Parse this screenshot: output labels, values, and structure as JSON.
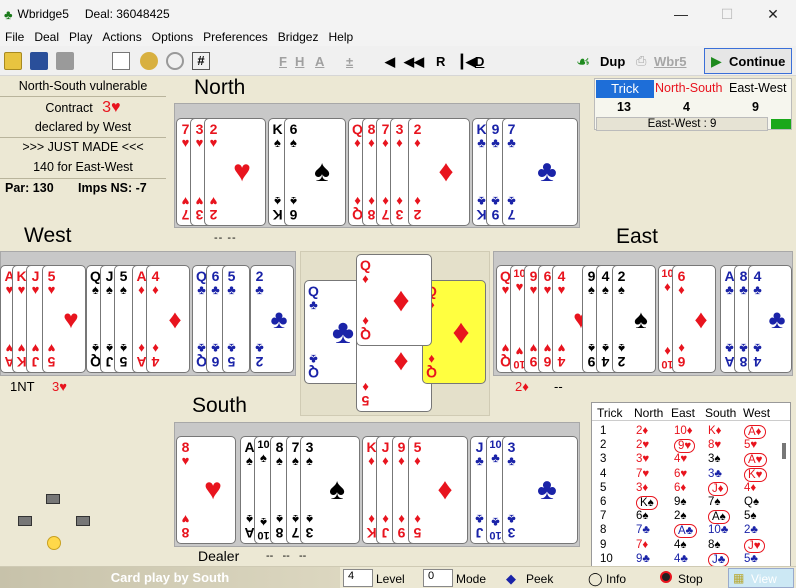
{
  "window": {
    "title": "Wbridge5",
    "deal_label": "Deal: 36048425"
  },
  "menu": [
    "File",
    "Deal",
    "Play",
    "Actions",
    "Options",
    "Preferences",
    "Bridgez",
    "Help"
  ],
  "toolbar": {
    "nav": [
      "F",
      "H",
      "A",
      "±",
      "R",
      "D"
    ],
    "dup_label": "Dup",
    "wbr5_label": "Wbr5",
    "continue_label": "Continue"
  },
  "info": {
    "vulnerability": "North-South vulnerable",
    "contract_label": "Contract",
    "contract": "3♥",
    "declarer": "declared by West",
    "result": ">>> JUST MADE <<<",
    "points": "140 for East-West",
    "par": "Par: 130",
    "imps": "Imps NS: -7"
  },
  "seats": {
    "north": "North",
    "west": "West",
    "east": "East",
    "south": "South",
    "north_marks": "-- --",
    "west_bid": "1NT",
    "west_bid2": "3♥",
    "east_bid": "2♦",
    "east_marks": "--",
    "dealer": "Dealer",
    "south_marks": "--   --   --"
  },
  "hands": {
    "north": [
      {
        "r": "7",
        "s": "♥",
        "c": "red"
      },
      {
        "r": "3",
        "s": "♥",
        "c": "red"
      },
      {
        "r": "2",
        "s": "♥",
        "c": "red"
      },
      {
        "r": "K",
        "s": "♠",
        "c": "blk"
      },
      {
        "r": "6",
        "s": "♠",
        "c": "blk"
      },
      {
        "r": "Q",
        "s": "♦",
        "c": "red"
      },
      {
        "r": "8",
        "s": "♦",
        "c": "red"
      },
      {
        "r": "7",
        "s": "♦",
        "c": "red"
      },
      {
        "r": "3",
        "s": "♦",
        "c": "red"
      },
      {
        "r": "2",
        "s": "♦",
        "c": "red"
      },
      {
        "r": "K",
        "s": "♣",
        "c": "blu"
      },
      {
        "r": "9",
        "s": "♣",
        "c": "blu"
      },
      {
        "r": "7",
        "s": "♣",
        "c": "blu"
      }
    ],
    "west": [
      {
        "r": "A",
        "s": "♥",
        "c": "red"
      },
      {
        "r": "K",
        "s": "♥",
        "c": "red"
      },
      {
        "r": "J",
        "s": "♥",
        "c": "red"
      },
      {
        "r": "5",
        "s": "♥",
        "c": "red"
      },
      {
        "r": "Q",
        "s": "♠",
        "c": "blk"
      },
      {
        "r": "J",
        "s": "♠",
        "c": "blk"
      },
      {
        "r": "5",
        "s": "♠",
        "c": "blk"
      },
      {
        "r": "A",
        "s": "♦",
        "c": "red"
      },
      {
        "r": "4",
        "s": "♦",
        "c": "red"
      },
      {
        "r": "Q",
        "s": "♣",
        "c": "blu"
      },
      {
        "r": "6",
        "s": "♣",
        "c": "blu"
      },
      {
        "r": "5",
        "s": "♣",
        "c": "blu"
      },
      {
        "r": "2",
        "s": "♣",
        "c": "blu"
      }
    ],
    "east": [
      {
        "r": "Q",
        "s": "♥",
        "c": "red"
      },
      {
        "r": "10",
        "s": "♥",
        "c": "red"
      },
      {
        "r": "9",
        "s": "♥",
        "c": "red"
      },
      {
        "r": "6",
        "s": "♥",
        "c": "red"
      },
      {
        "r": "4",
        "s": "♥",
        "c": "red"
      },
      {
        "r": "9",
        "s": "♠",
        "c": "blk"
      },
      {
        "r": "4",
        "s": "♠",
        "c": "blk"
      },
      {
        "r": "2",
        "s": "♠",
        "c": "blk"
      },
      {
        "r": "10",
        "s": "♦",
        "c": "red"
      },
      {
        "r": "6",
        "s": "♦",
        "c": "red"
      },
      {
        "r": "A",
        "s": "♣",
        "c": "blu"
      },
      {
        "r": "8",
        "s": "♣",
        "c": "blu"
      },
      {
        "r": "4",
        "s": "♣",
        "c": "blu"
      }
    ],
    "south": [
      {
        "r": "8",
        "s": "♥",
        "c": "red"
      },
      {
        "r": "A",
        "s": "♠",
        "c": "blk"
      },
      {
        "r": "10",
        "s": "♠",
        "c": "blk"
      },
      {
        "r": "8",
        "s": "♠",
        "c": "blk"
      },
      {
        "r": "7",
        "s": "♠",
        "c": "blk"
      },
      {
        "r": "3",
        "s": "♠",
        "c": "blk"
      },
      {
        "r": "K",
        "s": "♦",
        "c": "red"
      },
      {
        "r": "J",
        "s": "♦",
        "c": "red"
      },
      {
        "r": "9",
        "s": "♦",
        "c": "red"
      },
      {
        "r": "5",
        "s": "♦",
        "c": "red"
      },
      {
        "r": "J",
        "s": "♣",
        "c": "blu"
      },
      {
        "r": "10",
        "s": "♣",
        "c": "blu"
      },
      {
        "r": "3",
        "s": "♣",
        "c": "blu"
      }
    ]
  },
  "trick_on_table": {
    "west": {
      "r": "Q",
      "s": "♣",
      "c": "blu"
    },
    "north": {
      "r": "Q",
      "s": "♦",
      "c": "red"
    },
    "east": {
      "r": "Q",
      "s": "♦",
      "c": "red"
    },
    "south": {
      "r": "5",
      "s": "♦",
      "c": "red"
    }
  },
  "score": {
    "trick_label": "Trick",
    "ns_label": "North-South",
    "ew_label": "East-West",
    "trick": "13",
    "ns": "4",
    "ew": "9",
    "summary": "East-West : 9"
  },
  "trick_table": {
    "headers": [
      "Trick",
      "North",
      "East",
      "South",
      "West"
    ],
    "rows": [
      [
        "1",
        "2♦",
        "10♦",
        "K♦",
        "A♦"
      ],
      [
        "2",
        "2♥",
        "9♥",
        "8♥",
        "5♥"
      ],
      [
        "3",
        "3♥",
        "4♥",
        "3♠",
        "A♥"
      ],
      [
        "4",
        "7♥",
        "6♥",
        "3♣",
        "K♥"
      ],
      [
        "5",
        "3♦",
        "6♦",
        "J♦",
        "4♦"
      ],
      [
        "6",
        "K♠",
        "9♠",
        "7♠",
        "Q♠"
      ],
      [
        "7",
        "6♠",
        "2♠",
        "A♠",
        "5♠"
      ],
      [
        "8",
        "7♣",
        "A♣",
        "10♣",
        "2♣"
      ],
      [
        "9",
        "7♦",
        "4♠",
        "8♠",
        "J♥"
      ],
      [
        "10",
        "9♣",
        "4♣",
        "J♣",
        "5♣"
      ]
    ],
    "circled": [
      [
        1,
        4
      ],
      [
        2,
        2
      ],
      [
        3,
        4
      ],
      [
        4,
        4
      ],
      [
        5,
        3
      ],
      [
        6,
        1
      ],
      [
        7,
        3
      ],
      [
        8,
        2
      ],
      [
        9,
        4
      ],
      [
        10,
        3
      ]
    ]
  },
  "status": {
    "caption": "Card play by South",
    "level_value": "4",
    "level_label": "Level",
    "mode_value": "0",
    "mode_label": "Mode",
    "peek_label": "Peek",
    "info_label": "Info",
    "stop_label": "Stop",
    "view_label": "View"
  },
  "colors": {
    "red": "#e8141e",
    "black": "#000000",
    "blue": "#1a23a8",
    "highlight": "#ffff40"
  }
}
